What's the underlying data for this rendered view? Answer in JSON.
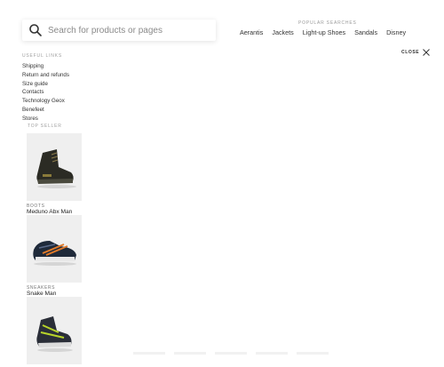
{
  "search": {
    "placeholder": "Search for products or pages"
  },
  "popular": {
    "title": "Popular searches",
    "items": [
      "Aerantis",
      "Jackets",
      "Light-up Shoes",
      "Sandals",
      "Disney"
    ]
  },
  "close": {
    "label": "Close"
  },
  "useful_links": {
    "title": "Useful links",
    "items": [
      "Shipping",
      "Return and refunds",
      "Size guide",
      "Contacts",
      "Technology Geox",
      "Benefeet",
      "Stores"
    ]
  },
  "top_seller": {
    "title": "Top seller",
    "products": [
      {
        "category": "Boots",
        "name": "Meduno Abx Man"
      },
      {
        "category": "Sneakers",
        "name": "Snake Man"
      },
      {
        "category": "",
        "name": ""
      }
    ]
  },
  "colors": {
    "background": "#ffffff",
    "text": "#333333",
    "muted": "#9a9a9a",
    "product_bg": "#efefef"
  }
}
